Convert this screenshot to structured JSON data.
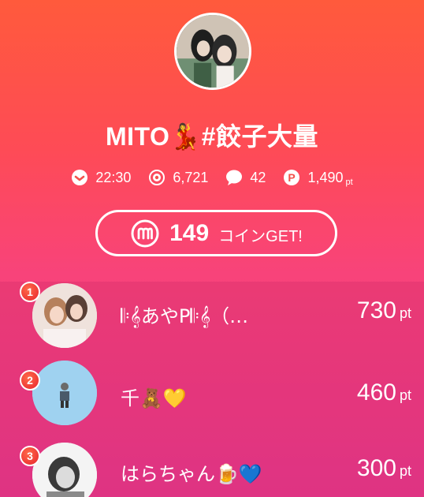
{
  "profile": {
    "avatar_alt": "profile-photo",
    "username": "MITO💃#餃子大量"
  },
  "stats": {
    "time": "22:30",
    "viewers": "6,721",
    "comments": "42",
    "points": "1,490",
    "points_unit": "pt"
  },
  "coin_button": {
    "amount": "149",
    "suffix": "コインGET!"
  },
  "ranking": [
    {
      "rank": "1",
      "name": "𝄆𝄞あやP𝄆𝄞（…",
      "points": "730",
      "unit": "pt"
    },
    {
      "rank": "2",
      "name": "千🧸💛",
      "points": "460",
      "unit": "pt"
    },
    {
      "rank": "3",
      "name": "はらちゃん🍺💙",
      "points": "300",
      "unit": "pt"
    }
  ],
  "colors": {
    "gradient_top": "#ff5a3c",
    "gradient_bottom": "#e93a8d",
    "badge": "#e8242c"
  },
  "icons": {
    "time": "clock-icon",
    "viewers": "eye-icon",
    "comments": "comment-bubble-icon",
    "points": "points-coin-icon",
    "coin": "m-coin-icon"
  }
}
